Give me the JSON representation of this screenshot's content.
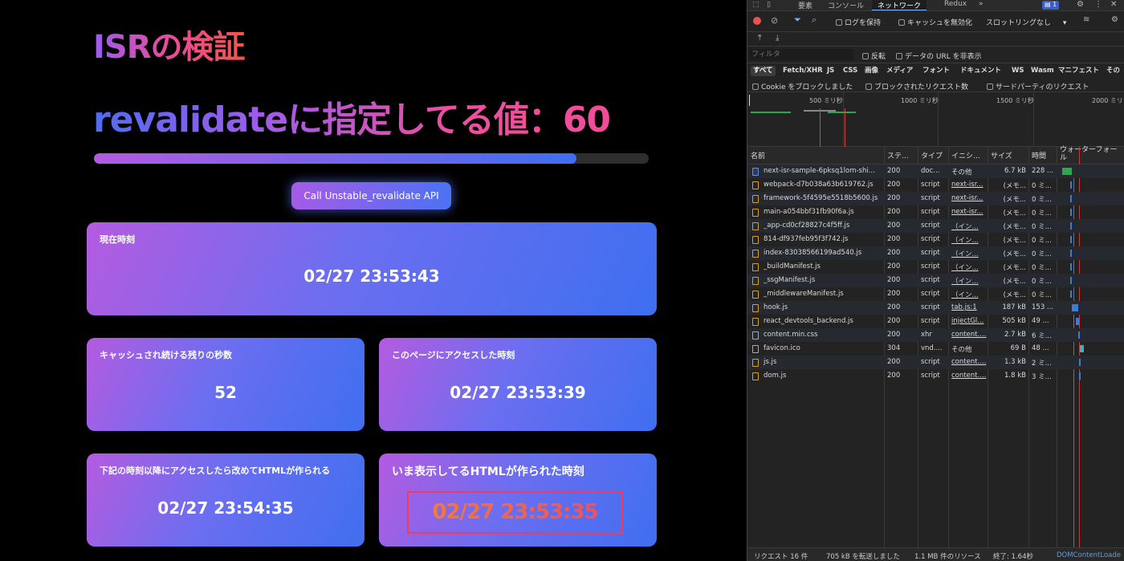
{
  "page": {
    "title": "ISRの検証",
    "revalidate_text": "revalidateに指定してる値：60",
    "progress": 0.87,
    "api_button_label": "Call Unstable_revalidate API",
    "cards": {
      "current_time": {
        "label": "現在時刻",
        "value": "02/27 23:53:43"
      },
      "remaining_seconds": {
        "label": "キャッシュされ続ける残りの秒数",
        "value": "52"
      },
      "accessed_time": {
        "label": "このページにアクセスした時刻",
        "value": "02/27 23:53:39"
      },
      "regen_after": {
        "label": "下記の時刻以降にアクセスしたら改めてHTMLが作られる",
        "value": "02/27 23:54:35"
      },
      "html_created": {
        "label": "いま表示してるHTMLが作られた時刻",
        "value": "02/27 23:53:35"
      }
    }
  },
  "devtools": {
    "tabs": [
      "要素",
      "コンソール",
      "ネットワーク",
      "Redux",
      "»"
    ],
    "issues_badge": "1",
    "toolbar": {
      "preserve_log": "ログを保持",
      "disable_cache": "キャッシュを無効化",
      "throttling": "スロットリングなし"
    },
    "filter": {
      "placeholder": "フィルタ",
      "invert": "反転",
      "hide_data_urls": "データの URL を非表示"
    },
    "types": [
      "すべて",
      "Fetch/XHR",
      "JS",
      "CSS",
      "画像",
      "メディア",
      "フォント",
      "ドキュメント",
      "WS",
      "Wasm",
      "マニフェスト",
      "その"
    ],
    "options": {
      "blocked_cookies": "Cookie をブロックしました",
      "blocked_requests": "ブロックされたリクエスト数",
      "third_party": "サードパーティのリクエスト"
    },
    "overview_labels": [
      "500 ミリ秒",
      "1000 ミリ秒",
      "1500 ミリ秒",
      "2000 ミリ"
    ],
    "columns": [
      "名前",
      "ステ...",
      "タイプ",
      "イニシ...",
      "サイズ",
      "時間",
      "ウォーターフォール"
    ],
    "requests": [
      {
        "name": "next-isr-sample-6pksq1lom-shi...",
        "status": "200",
        "type": "doc...",
        "initiator": "その他",
        "size": "6.7 kB",
        "time": "228 ...",
        "kind": "doc"
      },
      {
        "name": "webpack-d7b038a63b619762.js",
        "status": "200",
        "type": "script",
        "initiator": "next-isr...",
        "size": "(メモ...",
        "time": "0 ミ...",
        "kind": "script"
      },
      {
        "name": "framework-5f4595e5518b5600.js",
        "status": "200",
        "type": "script",
        "initiator": "next-isr...",
        "size": "(メモ...",
        "time": "0 ミ...",
        "kind": "script"
      },
      {
        "name": "main-a054bbf31fb90f6a.js",
        "status": "200",
        "type": "script",
        "initiator": "next-isr...",
        "size": "(メモ...",
        "time": "0 ミ...",
        "kind": "script"
      },
      {
        "name": "_app-cd0cf28827c4f5ff.js",
        "status": "200",
        "type": "script",
        "initiator": "（イン...",
        "size": "(メモ...",
        "time": "0 ミ...",
        "kind": "script"
      },
      {
        "name": "814-df937feb95f3f742.js",
        "status": "200",
        "type": "script",
        "initiator": "（イン...",
        "size": "(メモ...",
        "time": "0 ミ...",
        "kind": "script"
      },
      {
        "name": "index-83038566199ad540.js",
        "status": "200",
        "type": "script",
        "initiator": "（イン...",
        "size": "(メモ...",
        "time": "0 ミ...",
        "kind": "script"
      },
      {
        "name": "_buildManifest.js",
        "status": "200",
        "type": "script",
        "initiator": "（イン...",
        "size": "(メモ...",
        "time": "0 ミ...",
        "kind": "script"
      },
      {
        "name": "_ssgManifest.js",
        "status": "200",
        "type": "script",
        "initiator": "（イン...",
        "size": "(メモ...",
        "time": "0 ミ...",
        "kind": "script"
      },
      {
        "name": "_middlewareManifest.js",
        "status": "200",
        "type": "script",
        "initiator": "（イン...",
        "size": "(メモ...",
        "time": "0 ミ...",
        "kind": "script"
      },
      {
        "name": "hook.js",
        "status": "200",
        "type": "script",
        "initiator": "tab.js:1",
        "size": "187 kB",
        "time": "153 ...",
        "kind": "script"
      },
      {
        "name": "react_devtools_backend.js",
        "status": "200",
        "type": "script",
        "initiator": "injectGl...",
        "size": "505 kB",
        "time": "49 ...",
        "kind": "script"
      },
      {
        "name": "content.min.css",
        "status": "200",
        "type": "xhr",
        "initiator": "content....",
        "size": "2.7 kB",
        "time": "6 ミ...",
        "kind": "plain"
      },
      {
        "name": "favicon.ico",
        "status": "304",
        "type": "vnd....",
        "initiator": "その他",
        "size": "69 B",
        "time": "48 ...",
        "kind": "plain"
      },
      {
        "name": "js.js",
        "status": "200",
        "type": "script",
        "initiator": "content....",
        "size": "1.3 kB",
        "time": "2 ミ...",
        "kind": "script"
      },
      {
        "name": "dom.js",
        "status": "200",
        "type": "script",
        "initiator": "content....",
        "size": "1.8 kB",
        "time": "3 ミ...",
        "kind": "script"
      }
    ],
    "statusbar": {
      "requests": "リクエスト 16 件",
      "transferred": "705 kB を転送しました",
      "resources": "1.1 MB 件のリソース",
      "finish": "終了: 1.64秒",
      "dcl": "DOMContentLoade"
    }
  }
}
